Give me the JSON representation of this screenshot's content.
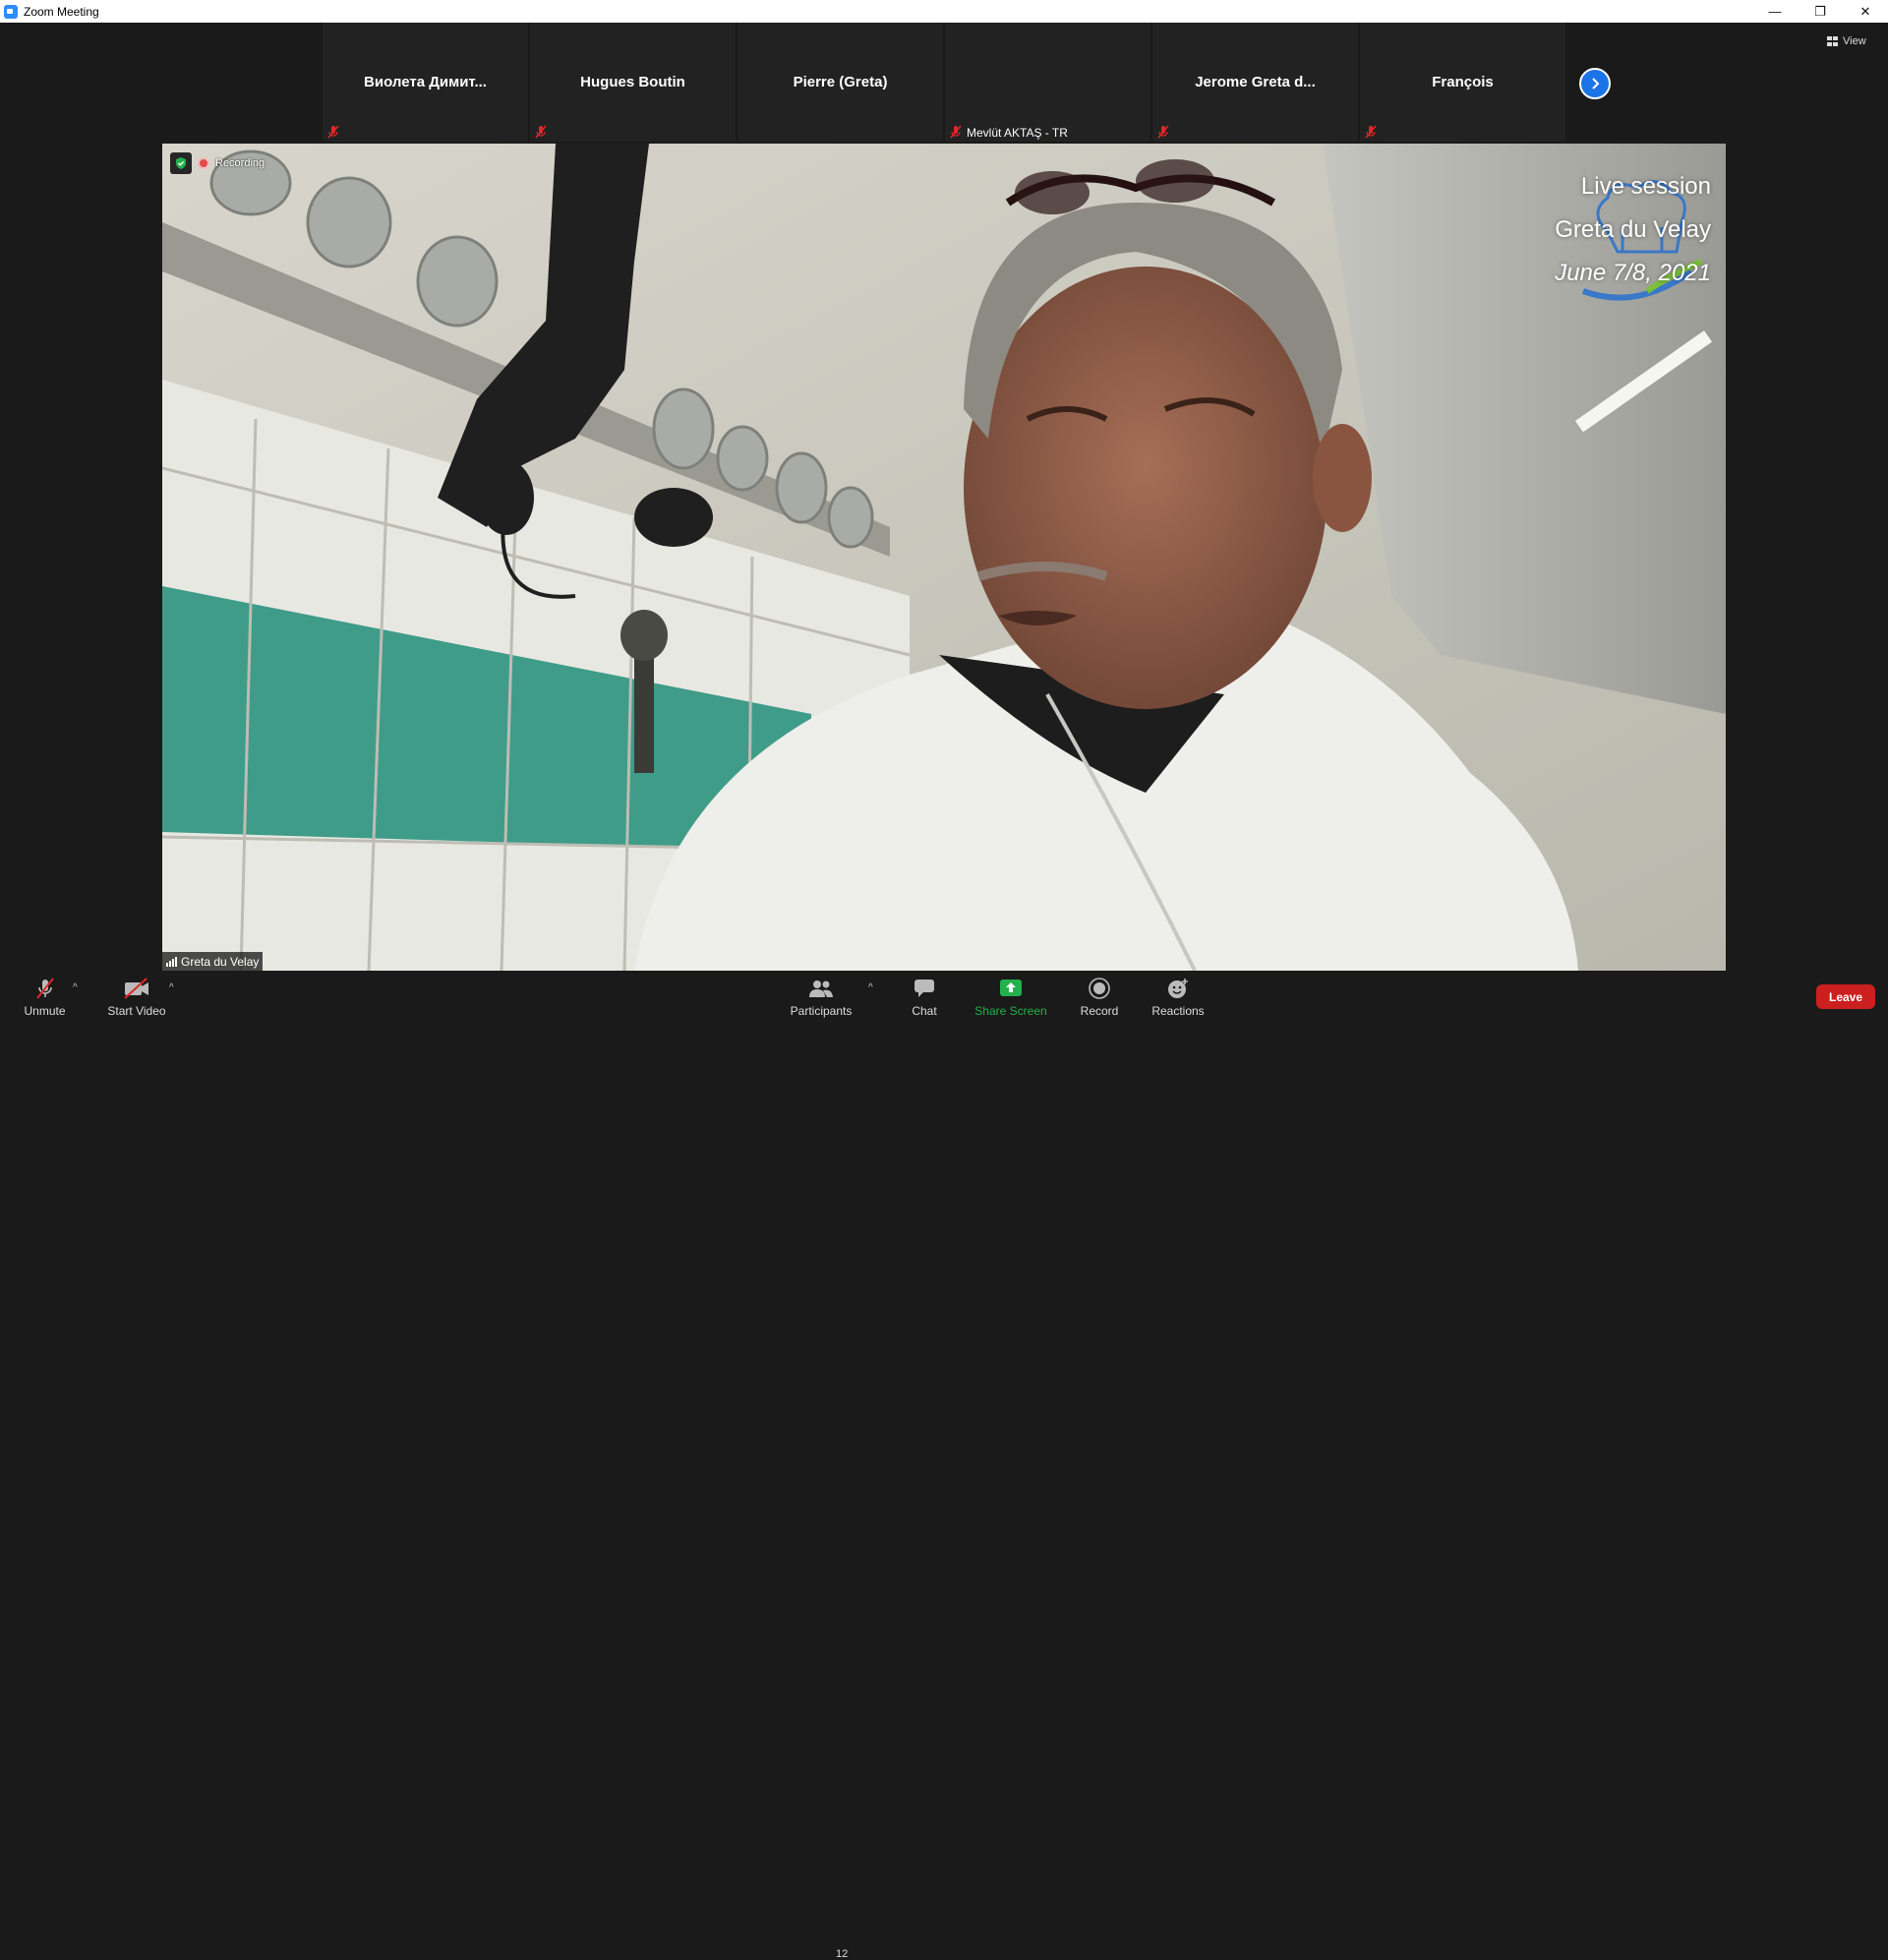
{
  "window": {
    "title": "Zoom Meeting"
  },
  "gallery": {
    "tiles": [
      {
        "center_name": "Виолета  Димит...",
        "bottom_name": "",
        "muted": true
      },
      {
        "center_name": "Hugues Boutin",
        "bottom_name": "",
        "muted": true
      },
      {
        "center_name": "Pierre (Greta)",
        "bottom_name": "",
        "muted": false
      },
      {
        "center_name": "",
        "bottom_name": "Mevlüt AKTAŞ - TR",
        "muted": true
      },
      {
        "center_name": "Jerome Greta d...",
        "bottom_name": "",
        "muted": true
      },
      {
        "center_name": "François",
        "bottom_name": "",
        "muted": true
      }
    ],
    "view_label": "View"
  },
  "main_video": {
    "recording_label": "Recording",
    "overlay": {
      "line1": "Live session",
      "line2": "Greta du Velay",
      "line3": "June 7/8, 2021"
    },
    "speaker_name": "Greta du Velay"
  },
  "toolbar": {
    "unmute_label": "Unmute",
    "start_video_label": "Start Video",
    "participants_label": "Participants",
    "participants_count": "12",
    "chat_label": "Chat",
    "share_screen_label": "Share Screen",
    "record_label": "Record",
    "reactions_label": "Reactions",
    "leave_label": "Leave"
  },
  "colors": {
    "accent": "#2D8CFF",
    "share_green": "#22b14c",
    "leave_red": "#cc1f1f",
    "muted_red": "#e02828"
  }
}
